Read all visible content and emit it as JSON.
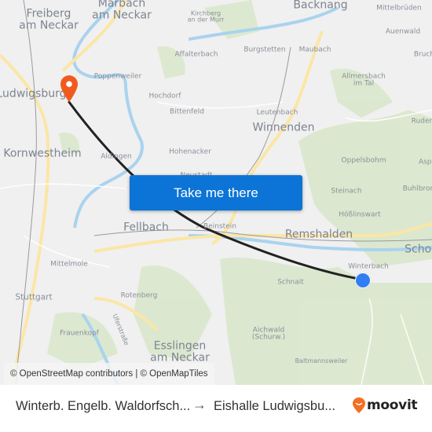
{
  "map": {
    "places": [
      {
        "name": "Freiberg am Neckar",
        "lines": [
          "Freiberg",
          "am Neckar"
        ],
        "size": "big"
      },
      {
        "name": "Marbach am Neckar",
        "lines": [
          "Marbach",
          "am Neckar"
        ],
        "size": "big"
      },
      {
        "name": "Kirchberg an der Murr",
        "lines": [
          "Kirchberg",
          "an der Murr"
        ],
        "size": "tiny"
      },
      {
        "name": "Backnang",
        "lines": [
          "Backnang"
        ],
        "size": "big"
      },
      {
        "name": "Mittelbrüden",
        "lines": [
          "Mittelbrüden"
        ],
        "size": "small"
      },
      {
        "name": "Auenwald",
        "lines": [
          "Auenwald"
        ],
        "size": "small"
      },
      {
        "name": "Affalterbach",
        "lines": [
          "Affalterbach"
        ],
        "size": "small"
      },
      {
        "name": "Burgstetten",
        "lines": [
          "Burgstetten"
        ],
        "size": "small"
      },
      {
        "name": "Maubach",
        "lines": [
          "Maubach"
        ],
        "size": "small"
      },
      {
        "name": "Bruch",
        "lines": [
          "Bruch"
        ],
        "size": "small"
      },
      {
        "name": "Poppenweiler",
        "lines": [
          "Poppenweiler"
        ],
        "size": "small"
      },
      {
        "name": "Allmersbach im Tal",
        "lines": [
          "Allmersbach",
          "im Tal"
        ],
        "size": "small"
      },
      {
        "name": "Ludwigsburg",
        "lines": [
          "Ludwigsburg"
        ],
        "size": "big"
      },
      {
        "name": "Hochdorf",
        "lines": [
          "Hochdorf"
        ],
        "size": "small"
      },
      {
        "name": "Bittenfeld",
        "lines": [
          "Bittenfeld"
        ],
        "size": "small"
      },
      {
        "name": "Leutenbach",
        "lines": [
          "Leutenbach"
        ],
        "size": "small"
      },
      {
        "name": "Winnenden",
        "lines": [
          "Winnenden"
        ],
        "size": "big"
      },
      {
        "name": "Ruders",
        "lines": [
          "Ruder"
        ],
        "size": "small"
      },
      {
        "name": "Kornwestheim",
        "lines": [
          "Kornwestheim"
        ],
        "size": "big"
      },
      {
        "name": "Aldingen",
        "lines": [
          "Aldingen"
        ],
        "size": "small"
      },
      {
        "name": "Hohenacker",
        "lines": [
          "Hohenacker"
        ],
        "size": "small"
      },
      {
        "name": "Oppelsbohm",
        "lines": [
          "Oppelsbohm"
        ],
        "size": "small"
      },
      {
        "name": "Aspe",
        "lines": [
          "Aspe"
        ],
        "size": "small"
      },
      {
        "name": "Neustadt",
        "lines": [
          "Neustadt"
        ],
        "size": "small"
      },
      {
        "name": "Steinach",
        "lines": [
          "Steinach"
        ],
        "size": "small"
      },
      {
        "name": "Buhlbronn",
        "lines": [
          "Buhlbron"
        ],
        "size": "small"
      },
      {
        "name": "Hößlinswart",
        "lines": [
          "Hößlinswart"
        ],
        "size": "small"
      },
      {
        "name": "Fellbach",
        "lines": [
          "Fellbach"
        ],
        "size": "big"
      },
      {
        "name": "Beinstein",
        "lines": [
          "Beinstein"
        ],
        "size": "small"
      },
      {
        "name": "Remshalden",
        "lines": [
          "Remshalden"
        ],
        "size": "big"
      },
      {
        "name": "Schorndorf",
        "lines": [
          "Schor"
        ],
        "size": "big"
      },
      {
        "name": "Mittelmole",
        "lines": [
          "Mittelmole"
        ],
        "size": "small"
      },
      {
        "name": "Winterbach",
        "lines": [
          "Winterbach"
        ],
        "size": "small"
      },
      {
        "name": "Stuttgart",
        "lines": [
          "Stuttgart"
        ],
        "size": "mid"
      },
      {
        "name": "Schnait",
        "lines": [
          "Schnait"
        ],
        "size": "small"
      },
      {
        "name": "Rotenberg",
        "lines": [
          "Rotenberg"
        ],
        "size": "small"
      },
      {
        "name": "Uferstraße",
        "lines": [
          "Uferstraße"
        ],
        "size": "tiny"
      },
      {
        "name": "Frauenkopf",
        "lines": [
          "Frauenkopf"
        ],
        "size": "small"
      },
      {
        "name": "Aichwald (Schurw.)",
        "lines": [
          "Aichwald",
          "(Schurw.)"
        ],
        "size": "small"
      },
      {
        "name": "Esslingen am Neckar",
        "lines": [
          "Esslingen",
          "am Neckar"
        ],
        "size": "big"
      },
      {
        "name": "Baltmannsweiler",
        "lines": [
          "Baltmannsweiler"
        ],
        "size": "tiny"
      }
    ],
    "origin_marker_color": "#2f7ef2",
    "destination_marker_color": "#f15a1f",
    "route_color": "#222222"
  },
  "cta": {
    "label": "Take me there",
    "color": "#0c74d6"
  },
  "attribution": "© OpenStreetMap contributors | © OpenMapTiles",
  "footer": {
    "origin": "Winterb. Engelb. Waldorfsch...",
    "arrow": "→",
    "destination": "Eishalle Ludwigsbu...",
    "brand": "moovit",
    "brand_color": "#f36f21"
  }
}
